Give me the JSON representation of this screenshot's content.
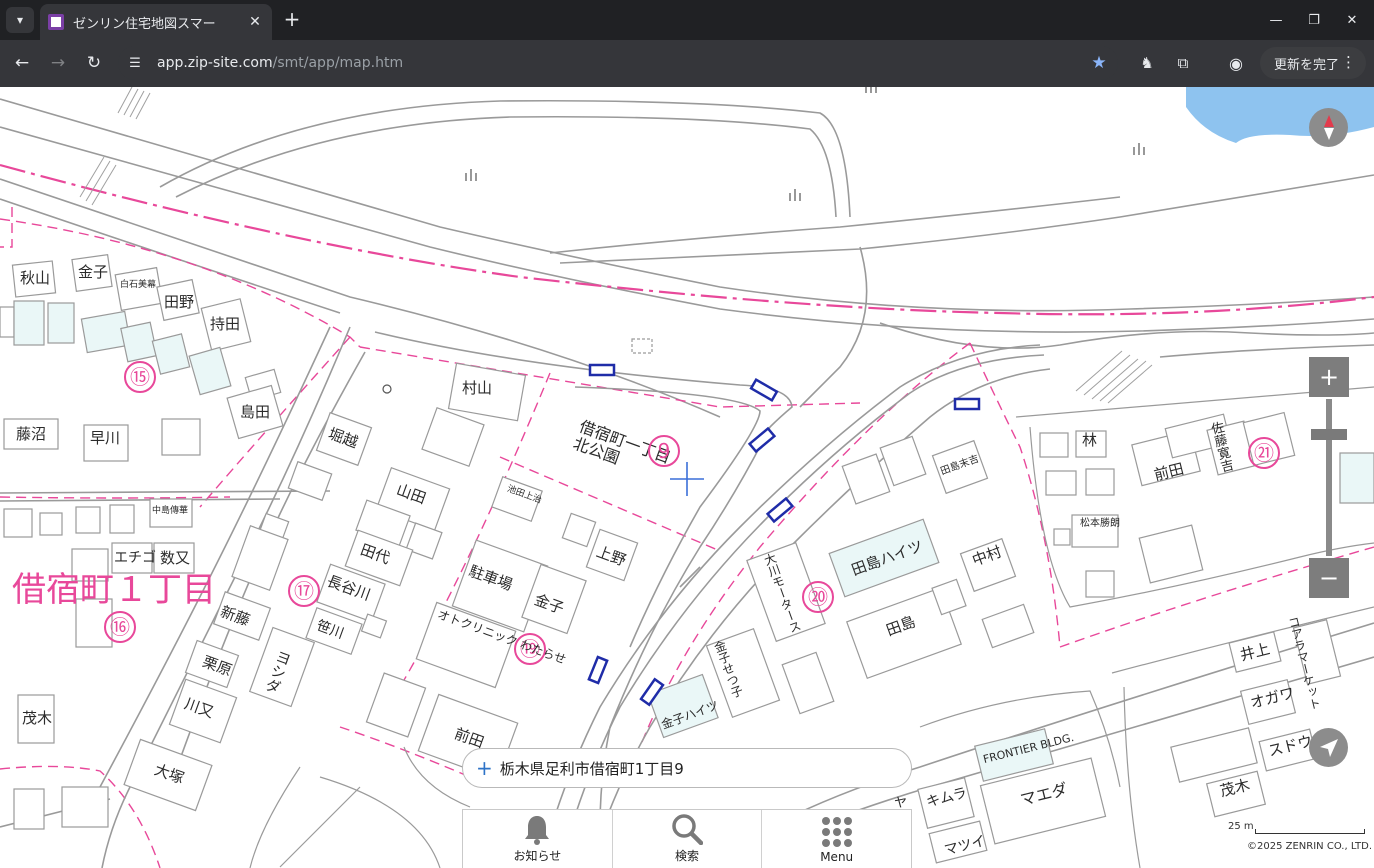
{
  "browser": {
    "tab_title": "ゼンリン住宅地図スマー",
    "url_host": "app.zip-site.com",
    "url_path": "/smt/app/map.htm",
    "update_button": "更新を完了"
  },
  "map": {
    "address": "栃木県足利市借宿町1丁目9",
    "scale_label": "25 m",
    "copyright": "©2025 ZENRIN CO., LTD.",
    "district_label": "借宿町１丁目",
    "park_name": "借宿町一丁目北公園",
    "block_numbers": [
      "⑮",
      "⑯",
      "⑰",
      "⑲",
      "⑳",
      "㉑",
      "9"
    ],
    "labels": [
      {
        "name": "秋山"
      },
      {
        "name": "金子"
      },
      {
        "name": "白石美幕"
      },
      {
        "name": "田野"
      },
      {
        "name": "持田"
      },
      {
        "name": "藤沼"
      },
      {
        "name": "早川"
      },
      {
        "name": "島田"
      },
      {
        "name": "村山"
      },
      {
        "name": "堀越"
      },
      {
        "name": "山田"
      },
      {
        "name": "田代"
      },
      {
        "name": "長谷川"
      },
      {
        "name": "笹川"
      },
      {
        "name": "ヨシダ"
      },
      {
        "name": "新藤"
      },
      {
        "name": "栗原"
      },
      {
        "name": "川又"
      },
      {
        "name": "茂木"
      },
      {
        "name": "大塚"
      },
      {
        "name": "中島傳華"
      },
      {
        "name": "エチゴ"
      },
      {
        "name": "数又"
      },
      {
        "name": "駐車場"
      },
      {
        "name": "金子"
      },
      {
        "name": "上野"
      },
      {
        "name": "池田上治"
      },
      {
        "name": "オトクリニック わたらせ"
      },
      {
        "name": "前田"
      },
      {
        "name": "田島ハイツ"
      },
      {
        "name": "田島"
      },
      {
        "name": "中村"
      },
      {
        "name": "田島末吉"
      },
      {
        "name": "金子ハイツ"
      },
      {
        "name": "林"
      },
      {
        "name": "前田"
      },
      {
        "name": "佐藤寛吉"
      },
      {
        "name": "松本勝朗"
      },
      {
        "name": "井上"
      },
      {
        "name": "オガワ"
      },
      {
        "name": "茂木"
      },
      {
        "name": "スドウ"
      },
      {
        "name": "マエダ"
      },
      {
        "name": "キムラ"
      },
      {
        "name": "FRONTIER BLDG."
      },
      {
        "name": "コアラマーケット"
      },
      {
        "name": "金子せつ子"
      },
      {
        "name": "大川モータース"
      },
      {
        "name": "ヤ"
      },
      {
        "name": "マツイ"
      }
    ]
  },
  "nav": {
    "notice": "お知らせ",
    "search": "検索",
    "menu": "Menu"
  }
}
